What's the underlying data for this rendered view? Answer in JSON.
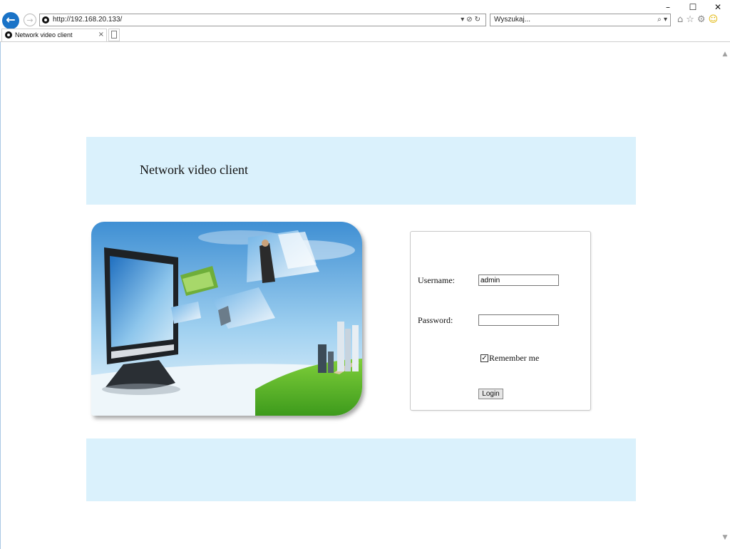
{
  "window": {
    "minimize": "–",
    "maximize": "☐",
    "close": "✕"
  },
  "navbar": {
    "url": "http://192.168.20.133/",
    "search_placeholder": "Wyszukaj..."
  },
  "tabs": [
    {
      "title": "Network video client",
      "close": "×"
    }
  ],
  "page": {
    "header_title": "Network video client",
    "login": {
      "username_label": "Username:",
      "username_value": "admin",
      "password_label": "Password:",
      "password_value": "",
      "remember_label": "Remember me",
      "remember_checked": true,
      "login_button": "Login"
    }
  },
  "colors": {
    "band": "#daf1fc",
    "back_button": "#1a73c7"
  }
}
